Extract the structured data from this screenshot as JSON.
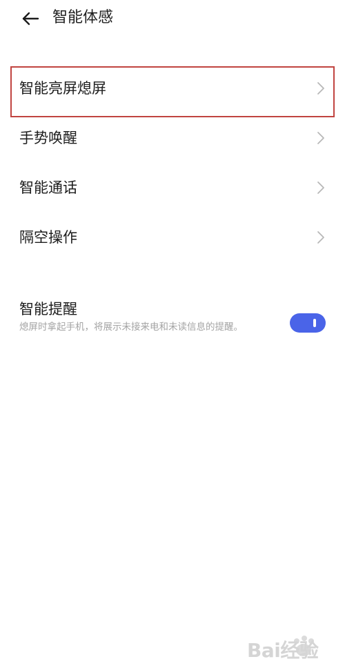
{
  "header": {
    "title": "智能体感",
    "back_icon": "arrow-left-icon"
  },
  "menu": {
    "items": [
      {
        "label": "智能亮屏熄屏",
        "icon": "chevron-right-icon"
      },
      {
        "label": "手势唤醒",
        "icon": "chevron-right-icon"
      },
      {
        "label": "智能通话",
        "icon": "chevron-right-icon"
      },
      {
        "label": "隔空操作",
        "icon": "chevron-right-icon"
      }
    ]
  },
  "smart_reminder": {
    "title": "智能提醒",
    "description": "熄屏时拿起手机，将展示未接来电和未读信息的提醒。",
    "enabled": true
  },
  "colors": {
    "highlight_border": "#c0433f",
    "toggle_on": "#4a64e8",
    "description_text": "#a4a4a4"
  },
  "watermark": {
    "text": "Bai经验"
  }
}
